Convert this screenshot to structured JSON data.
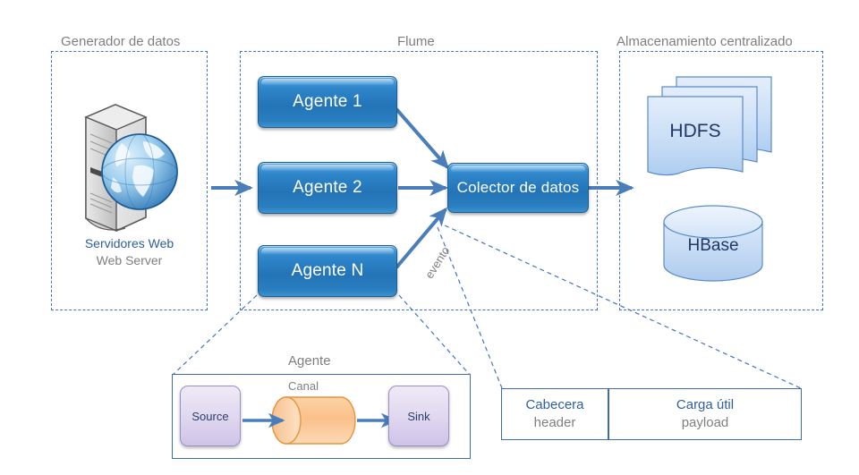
{
  "diagram": {
    "title_generator": "Generador de datos",
    "title_flume": "Flume",
    "title_storage": "Almacenamiento centralizado",
    "title_agent_detail": "Agente"
  },
  "generator": {
    "server_icon": "web-server-tower-icon",
    "globe_icon": "globe-icon",
    "label_es": "Servidores Web",
    "label_en": "Web Server"
  },
  "flume": {
    "agents": [
      {
        "label": "Agente 1"
      },
      {
        "label": "Agente 2"
      },
      {
        "label": "Agente N"
      }
    ],
    "collector": "Colector de datos",
    "event_label": "evento"
  },
  "storage": {
    "hdfs": "HDFS",
    "hbase": "HBase",
    "hdfs_icon": "document-stack-icon",
    "hbase_icon": "database-cylinder-icon"
  },
  "agent_detail": {
    "source": "Source",
    "channel": "Canal",
    "sink": "Sink"
  },
  "event_structure": {
    "header_es": "Cabecera",
    "header_en": "header",
    "payload_es": "Carga útil",
    "payload_en": "payload"
  },
  "colors": {
    "group_border": "#4472c4",
    "box_blue": "#2f86ca",
    "arrow_blue": "#4a7ebb",
    "text_gray": "#7f7f7f",
    "text_blue": "#2e5f9e",
    "purple_box": "#cfc3e7",
    "channel_orange": "#f6ab63",
    "storage_blue": "#c3d9f4"
  }
}
